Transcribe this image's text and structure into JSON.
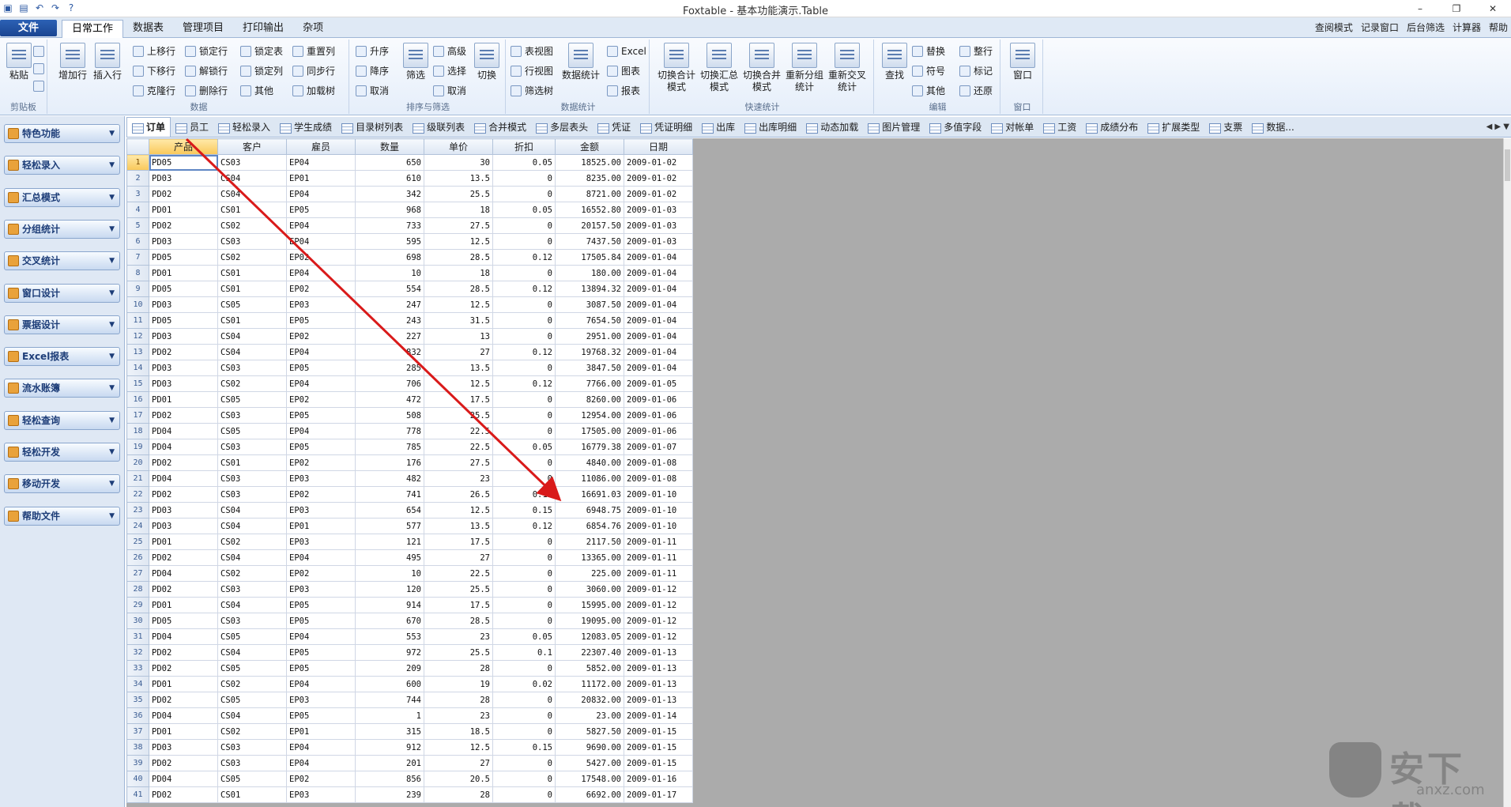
{
  "app": {
    "title": "Foxtable - 基本功能演示.Table",
    "file_label": "文件",
    "min": "–",
    "restore": "❐",
    "close": "✕"
  },
  "quick_icons": [
    "app-icon",
    "save-icon",
    "undo-icon",
    "redo-icon",
    "help-icon"
  ],
  "ribbon_tabs": [
    "日常工作",
    "数据表",
    "管理项目",
    "打印输出",
    "杂项"
  ],
  "right_tools": [
    "查阅模式",
    "记录窗口",
    "后台筛选",
    "计算器",
    "帮助"
  ],
  "ribbon": {
    "clipboard": {
      "label": "剪贴板",
      "paste": "粘贴"
    },
    "data": {
      "label": "数据",
      "add_row": "增加行",
      "insert_row": "插入行",
      "move_up": "上移行",
      "move_down": "下移行",
      "clone": "克隆行",
      "lock_row": "锁定行",
      "unlock": "解锁行",
      "delete": "删除行",
      "lock_table": "锁定表",
      "lock_col": "锁定列",
      "other": "其他",
      "reset_col": "重置列",
      "sync": "同步行",
      "load_tree": "加载树"
    },
    "sort": {
      "label": "排序与筛选",
      "asc": "升序",
      "desc": "降序",
      "cancel": "取消",
      "filter": "筛选",
      "advanced": "高级",
      "select": "选择",
      "cancel2": "取消",
      "switch": "切换"
    },
    "stats": {
      "label": "数据统计",
      "data_stats": "数据统计",
      "table_view": "表视图",
      "row_view": "行视图",
      "filter_tree": "筛选树",
      "excel": "Excel",
      "chart": "图表",
      "report": "报表"
    },
    "quick": {
      "label": "快速统计",
      "b1": "切换合计模式",
      "b2": "切换汇总模式",
      "b3": "切换合并模式",
      "b4": "重新分组统计",
      "b5": "重新交叉统计"
    },
    "edit": {
      "label": "编辑",
      "find": "查找",
      "replace": "替换",
      "symbol": "符号",
      "other": "其他",
      "whole_row": "整行",
      "mark": "标记",
      "restore": "还原"
    },
    "window": {
      "label": "窗口",
      "window": "窗口"
    }
  },
  "sidebar": [
    "特色功能",
    "轻松录入",
    "汇总模式",
    "分组统计",
    "交叉统计",
    "窗口设计",
    "票据设计",
    "Excel报表",
    "流水账簿",
    "轻松查询",
    "轻松开发",
    "移动开发",
    "帮助文件"
  ],
  "doc_tabs": [
    "订单",
    "员工",
    "轻松录入",
    "学生成绩",
    "目录树列表",
    "级联列表",
    "合并模式",
    "多层表头",
    "凭证",
    "凭证明细",
    "出库",
    "出库明细",
    "动态加载",
    "图片管理",
    "多值字段",
    "对帐单",
    "工资",
    "成绩分布",
    "扩展类型",
    "支票",
    "数据..."
  ],
  "grid": {
    "columns": [
      "产品",
      "客户",
      "雇员",
      "数量",
      "单价",
      "折扣",
      "金额",
      "日期"
    ],
    "rows": [
      [
        "PD05",
        "CS03",
        "EP04",
        "650",
        "30",
        "0.05",
        "18525.00",
        "2009-01-02"
      ],
      [
        "PD03",
        "CS04",
        "EP01",
        "610",
        "13.5",
        "0",
        "8235.00",
        "2009-01-02"
      ],
      [
        "PD02",
        "CS04",
        "EP04",
        "342",
        "25.5",
        "0",
        "8721.00",
        "2009-01-02"
      ],
      [
        "PD01",
        "CS01",
        "EP05",
        "968",
        "18",
        "0.05",
        "16552.80",
        "2009-01-03"
      ],
      [
        "PD02",
        "CS02",
        "EP04",
        "733",
        "27.5",
        "0",
        "20157.50",
        "2009-01-03"
      ],
      [
        "PD03",
        "CS03",
        "EP04",
        "595",
        "12.5",
        "0",
        "7437.50",
        "2009-01-03"
      ],
      [
        "PD05",
        "CS02",
        "EP02",
        "698",
        "28.5",
        "0.12",
        "17505.84",
        "2009-01-04"
      ],
      [
        "PD01",
        "CS01",
        "EP04",
        "10",
        "18",
        "0",
        "180.00",
        "2009-01-04"
      ],
      [
        "PD05",
        "CS01",
        "EP02",
        "554",
        "28.5",
        "0.12",
        "13894.32",
        "2009-01-04"
      ],
      [
        "PD03",
        "CS05",
        "EP03",
        "247",
        "12.5",
        "0",
        "3087.50",
        "2009-01-04"
      ],
      [
        "PD05",
        "CS01",
        "EP05",
        "243",
        "31.5",
        "0",
        "7654.50",
        "2009-01-04"
      ],
      [
        "PD03",
        "CS04",
        "EP02",
        "227",
        "13",
        "0",
        "2951.00",
        "2009-01-04"
      ],
      [
        "PD02",
        "CS04",
        "EP04",
        "832",
        "27",
        "0.12",
        "19768.32",
        "2009-01-04"
      ],
      [
        "PD03",
        "CS03",
        "EP05",
        "285",
        "13.5",
        "0",
        "3847.50",
        "2009-01-04"
      ],
      [
        "PD03",
        "CS02",
        "EP04",
        "706",
        "12.5",
        "0.12",
        "7766.00",
        "2009-01-05"
      ],
      [
        "PD01",
        "CS05",
        "EP02",
        "472",
        "17.5",
        "0",
        "8260.00",
        "2009-01-06"
      ],
      [
        "PD02",
        "CS03",
        "EP05",
        "508",
        "25.5",
        "0",
        "12954.00",
        "2009-01-06"
      ],
      [
        "PD04",
        "CS05",
        "EP04",
        "778",
        "22.5",
        "0",
        "17505.00",
        "2009-01-06"
      ],
      [
        "PD04",
        "CS03",
        "EP05",
        "785",
        "22.5",
        "0.05",
        "16779.38",
        "2009-01-07"
      ],
      [
        "PD02",
        "CS01",
        "EP02",
        "176",
        "27.5",
        "0",
        "4840.00",
        "2009-01-08"
      ],
      [
        "PD04",
        "CS03",
        "EP03",
        "482",
        "23",
        "0",
        "11086.00",
        "2009-01-08"
      ],
      [
        "PD02",
        "CS03",
        "EP02",
        "741",
        "26.5",
        "0.15",
        "16691.03",
        "2009-01-10"
      ],
      [
        "PD03",
        "CS04",
        "EP03",
        "654",
        "12.5",
        "0.15",
        "6948.75",
        "2009-01-10"
      ],
      [
        "PD03",
        "CS04",
        "EP01",
        "577",
        "13.5",
        "0.12",
        "6854.76",
        "2009-01-10"
      ],
      [
        "PD01",
        "CS02",
        "EP03",
        "121",
        "17.5",
        "0",
        "2117.50",
        "2009-01-11"
      ],
      [
        "PD02",
        "CS04",
        "EP04",
        "495",
        "27",
        "0",
        "13365.00",
        "2009-01-11"
      ],
      [
        "PD04",
        "CS02",
        "EP02",
        "10",
        "22.5",
        "0",
        "225.00",
        "2009-01-11"
      ],
      [
        "PD02",
        "CS03",
        "EP03",
        "120",
        "25.5",
        "0",
        "3060.00",
        "2009-01-12"
      ],
      [
        "PD01",
        "CS04",
        "EP05",
        "914",
        "17.5",
        "0",
        "15995.00",
        "2009-01-12"
      ],
      [
        "PD05",
        "CS03",
        "EP05",
        "670",
        "28.5",
        "0",
        "19095.00",
        "2009-01-12"
      ],
      [
        "PD04",
        "CS05",
        "EP04",
        "553",
        "23",
        "0.05",
        "12083.05",
        "2009-01-12"
      ],
      [
        "PD02",
        "CS04",
        "EP05",
        "972",
        "25.5",
        "0.1",
        "22307.40",
        "2009-01-13"
      ],
      [
        "PD02",
        "CS05",
        "EP05",
        "209",
        "28",
        "0",
        "5852.00",
        "2009-01-13"
      ],
      [
        "PD01",
        "CS02",
        "EP04",
        "600",
        "19",
        "0.02",
        "11172.00",
        "2009-01-13"
      ],
      [
        "PD02",
        "CS05",
        "EP03",
        "744",
        "28",
        "0",
        "20832.00",
        "2009-01-13"
      ],
      [
        "PD04",
        "CS04",
        "EP05",
        "1",
        "23",
        "0",
        "23.00",
        "2009-01-14"
      ],
      [
        "PD01",
        "CS02",
        "EP01",
        "315",
        "18.5",
        "0",
        "5827.50",
        "2009-01-15"
      ],
      [
        "PD03",
        "CS03",
        "EP04",
        "912",
        "12.5",
        "0.15",
        "9690.00",
        "2009-01-15"
      ],
      [
        "PD02",
        "CS03",
        "EP04",
        "201",
        "27",
        "0",
        "5427.00",
        "2009-01-15"
      ],
      [
        "PD04",
        "CS05",
        "EP02",
        "856",
        "20.5",
        "0",
        "17548.00",
        "2009-01-16"
      ],
      [
        "PD02",
        "CS01",
        "EP03",
        "239",
        "28",
        "0",
        "6692.00",
        "2009-01-17"
      ]
    ]
  },
  "watermark": {
    "brand": "安下载",
    "url": "anxz.com"
  },
  "colors": {
    "accent": "#2c61b5",
    "annotation": "#d91a1a",
    "selected_header": "#f9c85a"
  }
}
